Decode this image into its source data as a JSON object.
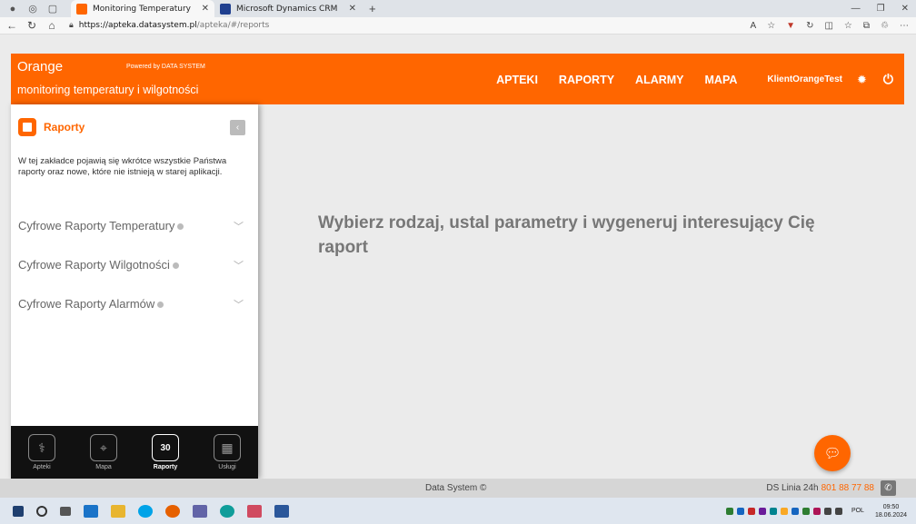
{
  "browser": {
    "tabs": [
      {
        "title": "Monitoring Temperatury",
        "active": true,
        "favicon_color": "#ff6600"
      },
      {
        "title": "Microsoft Dynamics CRM",
        "active": false,
        "favicon_color": "#1f3f8f"
      }
    ],
    "url_host": "https://apteka.datasystem.pl",
    "url_path": "/apteka/#/reports"
  },
  "header": {
    "brand": "Orange",
    "powered_by": "Powered by DATA SYSTEM",
    "subtitle": "monitoring temperatury i wilgotności",
    "nav": [
      "APTEKI",
      "RAPORTY",
      "ALARMY",
      "MAPA"
    ],
    "user": "KlientOrangeTest",
    "accent_color": "#ff6600"
  },
  "sidebar": {
    "title": "Raporty",
    "description": "W tej zakładce pojawią się wkrótce wszystkie Państwa raporty oraz nowe, które nie istnieją w starej aplikacji.",
    "menu": [
      {
        "label": "Cyfrowe Raporty Temperatury"
      },
      {
        "label": "Cyfrowe Raporty Wilgotności"
      },
      {
        "label": "Cyfrowe Raporty Alarmów"
      }
    ],
    "bottom_nav": [
      {
        "label": "Apteki",
        "icon": "pharmacy-icon",
        "glyph": "⚕"
      },
      {
        "label": "Mapa",
        "icon": "map-icon",
        "glyph": "⌖"
      },
      {
        "label": "Raporty",
        "icon": "calendar-icon",
        "glyph": "30"
      },
      {
        "label": "Usługi",
        "icon": "grid-icon",
        "glyph": "▦"
      }
    ]
  },
  "main": {
    "message": "Wybierz rodzaj, ustal parametry i wygeneruj interesujący Cię raport"
  },
  "footer": {
    "copyright": "Data System ©",
    "hotline_label": "DS Linia 24h",
    "hotline_number": "801 88 77 88"
  },
  "taskbar": {
    "lang": "POL",
    "time": "09:50",
    "date": "18.06.2024"
  }
}
